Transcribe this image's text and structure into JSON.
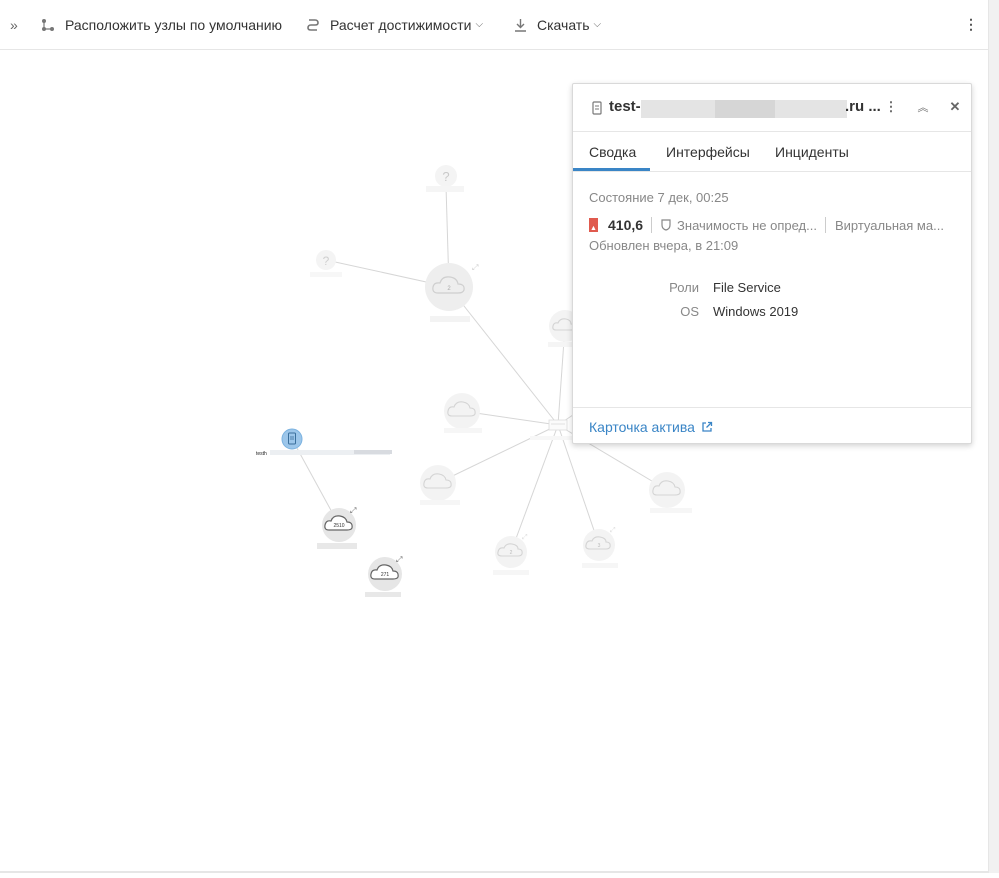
{
  "toolbar": {
    "expand_glyph": "»",
    "arrange_label": "Расположить узлы по умолчанию",
    "reach_label": "Расчет достижимости",
    "download_label": "Скачать",
    "more_glyph": "⋮"
  },
  "graph": {
    "node_labels": {
      "unknown_top": "?",
      "unknown_left": "?",
      "cloud_center": "2",
      "cloud_big": "2510",
      "cloud_small": "271",
      "cloud_bottom_a": "2",
      "cloud_bottom_b": "3"
    },
    "selected_node_label": "testh"
  },
  "panel": {
    "title_prefix": "test-",
    "title_suffix": ".ru ...",
    "tabs": [
      "Сводка",
      "Интерфейсы",
      "Инциденты"
    ],
    "active_tab": "Сводка",
    "status": "Состояние 7 дек, 00:25",
    "score": "410,6",
    "importance": "Значимость не опред...",
    "type": "Виртуальная ма...",
    "updated": "Обновлен вчера, в 21:09",
    "properties": [
      {
        "key": "Роли",
        "value": "File Service"
      },
      {
        "key": "OS",
        "value": "Windows 2019"
      }
    ],
    "asset_card_link": "Карточка актива",
    "severity_color": "#e05a4e",
    "accent_color": "#3a85c6"
  }
}
